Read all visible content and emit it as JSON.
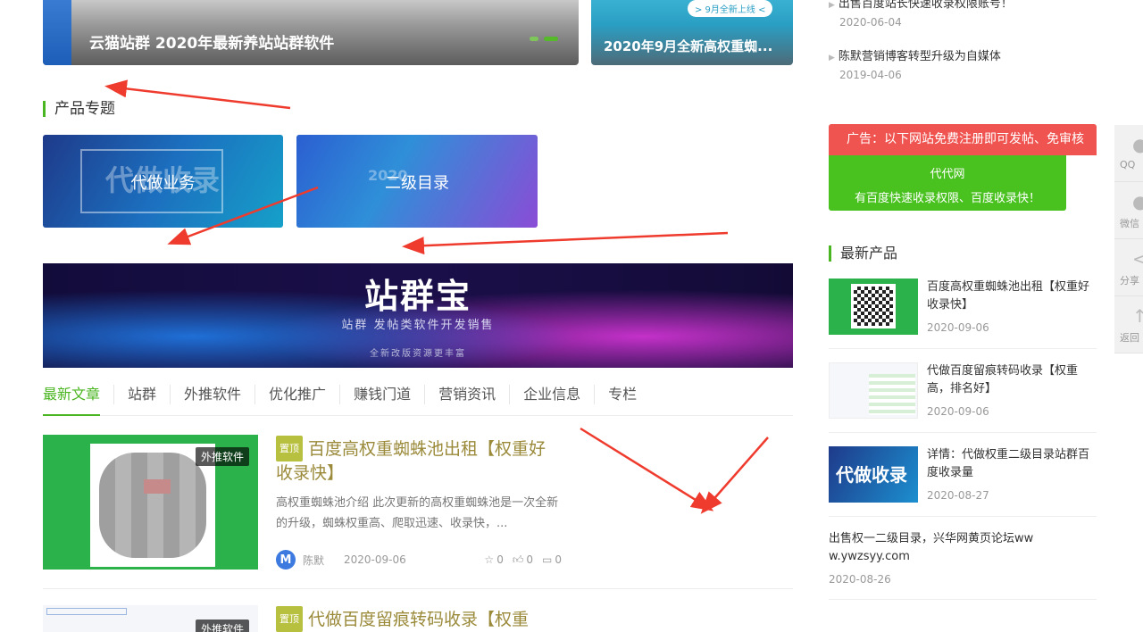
{
  "carousel": {
    "main_title": "云猫站群 2020年最新养站站群软件",
    "side_title": "2020年9月全新高权重蜘...",
    "side_pill": "> 9月全新上线 <"
  },
  "product_section": {
    "title": "产品专题",
    "tiles": [
      {
        "label": "代做业务",
        "bg_text": "代做收录"
      },
      {
        "label": "二级目录",
        "bg_text": "2020"
      }
    ]
  },
  "banner": {
    "title": "站群宝",
    "subtitle": "站群 发帖类软件开发销售",
    "note": "全新改版资源更丰富"
  },
  "tabs": [
    "最新文章",
    "站群",
    "外推软件",
    "优化推广",
    "赚钱门道",
    "营销资讯",
    "企业信息",
    "专栏"
  ],
  "articles": [
    {
      "tag": "置顶",
      "category_badge": "外推软件",
      "title": "百度高权重蜘蛛池出租【权重好收录快】",
      "desc": "高权重蜘蛛池介绍 此次更新的高权重蜘蛛池是一次全新的升级，蜘蛛权重高、爬取迅速、收录快，...",
      "author_initial": "M",
      "author": "陈默",
      "date": "2020-09-06",
      "stars": "0",
      "likes": "0",
      "comments": "0"
    },
    {
      "tag": "置顶",
      "category_badge": "外推软件",
      "title": "代做百度留痕转码收录【权重"
    }
  ],
  "sidebar": {
    "news": [
      {
        "title": "出售百度站长快速收录权限账号！",
        "date": "2020-06-04"
      },
      {
        "title": "陈默营销博客转型升级为自媒体",
        "date": "2019-04-06"
      }
    ],
    "ad_red": "广告：以下网站免费注册即可发帖、免审核",
    "ad_green_line1": "代代网",
    "ad_green_line2": "有百度快速收录权限、百度收录快！",
    "latest_title": "最新产品",
    "products": [
      {
        "title": "百度高权重蜘蛛池出租【权重好收录快】",
        "date": "2020-09-06"
      },
      {
        "title": "代做百度留痕转码收录【权重高，排名好】",
        "date": "2020-09-06"
      },
      {
        "title": "详情：代做权重二级目录站群百度收录量",
        "date": "2020-08-27",
        "img_text": "代做收录"
      },
      {
        "title": "出售权一二级目录，兴华网黄页论坛www.ywzsyy.com",
        "date": "2020-08-26"
      }
    ]
  },
  "float_bar": [
    "QQ",
    "微信",
    "分享",
    "返回"
  ]
}
